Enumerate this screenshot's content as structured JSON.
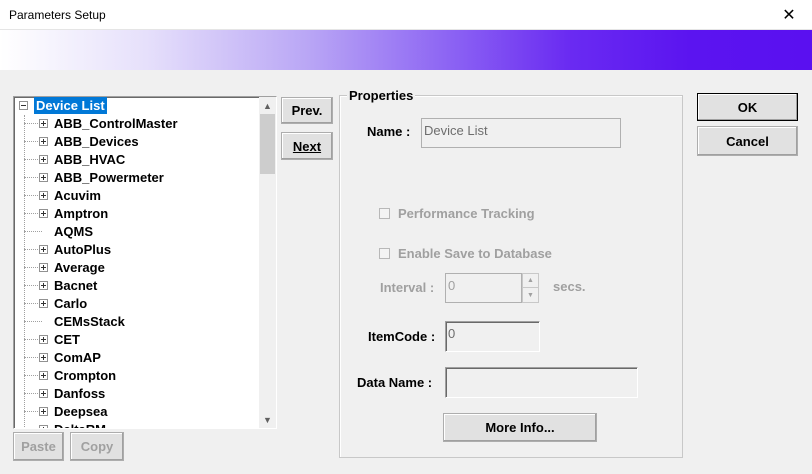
{
  "window": {
    "title": "Parameters Setup",
    "close_glyph": "✕"
  },
  "tree": {
    "root_label": "Device List",
    "items": [
      {
        "label": "ABB_ControlMaster",
        "expandable": true
      },
      {
        "label": "ABB_Devices",
        "expandable": true
      },
      {
        "label": "ABB_HVAC",
        "expandable": true
      },
      {
        "label": "ABB_Powermeter",
        "expandable": true
      },
      {
        "label": "Acuvim",
        "expandable": true
      },
      {
        "label": "Amptron",
        "expandable": true
      },
      {
        "label": "AQMS",
        "expandable": false
      },
      {
        "label": "AutoPlus",
        "expandable": true
      },
      {
        "label": "Average",
        "expandable": true
      },
      {
        "label": "Bacnet",
        "expandable": true
      },
      {
        "label": "Carlo",
        "expandable": true
      },
      {
        "label": "CEMsStack",
        "expandable": false
      },
      {
        "label": "CET",
        "expandable": true
      },
      {
        "label": "ComAP",
        "expandable": true
      },
      {
        "label": "Crompton",
        "expandable": true
      },
      {
        "label": "Danfoss",
        "expandable": true
      },
      {
        "label": "Deepsea",
        "expandable": true
      },
      {
        "label": "DeltaRM",
        "expandable": true
      }
    ],
    "scroll_up_glyph": "▲",
    "scroll_down_glyph": "▼"
  },
  "nav": {
    "prev_label": "Prev.",
    "next_label": "Next"
  },
  "tree_actions": {
    "paste_label": "Paste",
    "copy_label": "Copy"
  },
  "properties": {
    "legend": "Properties",
    "name_label": "Name :",
    "name_value": "Device List",
    "performance_tracking_label": "Performance Tracking",
    "performance_tracking_checked": false,
    "enable_save_label": "Enable Save to Database",
    "enable_save_checked": false,
    "interval_label": "Interval :",
    "interval_value": "0",
    "interval_unit": "secs.",
    "itemcode_label": "ItemCode :",
    "itemcode_value": "0",
    "dataname_label": "Data Name :",
    "dataname_value": "",
    "more_info_label": "More Info..."
  },
  "dialog_buttons": {
    "ok_label": "OK",
    "cancel_label": "Cancel"
  }
}
